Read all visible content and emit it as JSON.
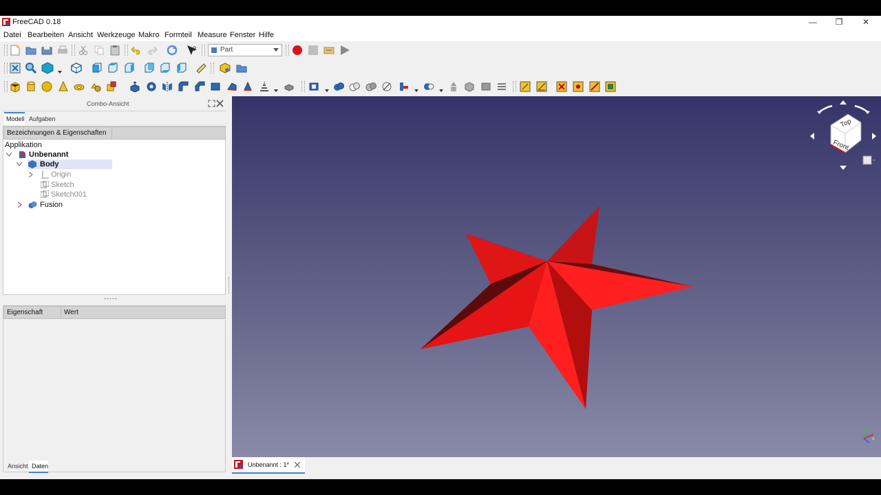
{
  "window": {
    "title": "FreeCAD 0.18"
  },
  "menu": [
    "Datei",
    "Bearbeiten",
    "Ansicht",
    "Werkzeuge",
    "Makro",
    "Formteil",
    "Measure",
    "Fenster",
    "Hilfe"
  ],
  "toolbar": {
    "workbench": "Part"
  },
  "combo": {
    "title": "Combo-Ansicht",
    "tabs": [
      "Modell",
      "Aufgaben"
    ],
    "tree_header": "Bezeichnungen & Eigenschaften",
    "app_label": "Applikation",
    "tree": {
      "doc": "Unbenannt",
      "body": "Body",
      "origin": "Origin",
      "sketch": "Sketch",
      "sketch001": "Sketch001",
      "fusion": "Fusion"
    },
    "splitter": "-----",
    "prop_cols": [
      "Eigenschaft",
      "Wert"
    ],
    "bottom_tabs": [
      "Ansicht",
      "Daten"
    ]
  },
  "navcube": {
    "top": "Top",
    "front": "Front"
  },
  "doc_tab": "Unbenannt : 1*",
  "colors": {
    "star": "#ff1a1a",
    "star_shade": "#b20e0e",
    "star_dark": "#5c0a0a",
    "record": "#d9121a",
    "selection": "#dfe4f8"
  }
}
